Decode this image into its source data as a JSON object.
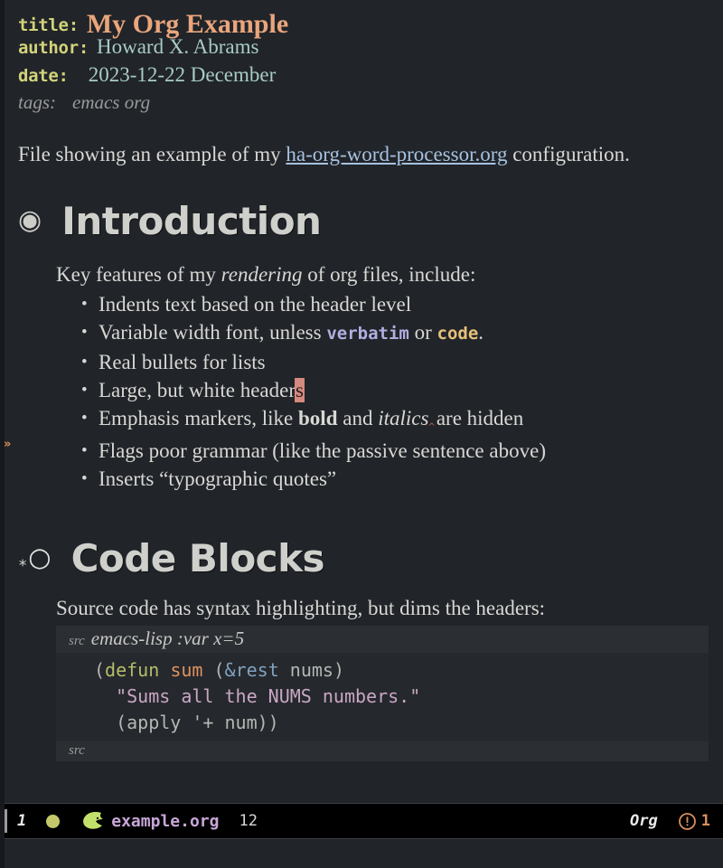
{
  "frame": {
    "background": "#212429",
    "accent_orange": "#d98f5a",
    "cursor_color": "#d6897e"
  },
  "keywords": [
    {
      "key": "title:",
      "value": "My Org Example"
    },
    {
      "key": "author:",
      "value": "Howard X. Abrams"
    },
    {
      "key": "date:",
      "value": "2023-12-22 December"
    }
  ],
  "tags": {
    "key": "tags:",
    "value": "emacs org"
  },
  "intro_paragraph": {
    "before_link": "File showing an example of my ",
    "link_text": "ha-org-word-processor.org",
    "after_link": " configuration."
  },
  "sections": [
    {
      "bullet": "filled-circle",
      "heading": "Introduction",
      "lead": {
        "before_italic": "Key features of my ",
        "italic": "rendering",
        "after_italic": " of org files, include:"
      },
      "items": [
        {
          "text": "Indents text based on the header level"
        },
        {
          "text": "Variable width font, unless ",
          "verbatim": "verbatim",
          "mid": " or ",
          "code": "code",
          "tail": "."
        },
        {
          "text": "Real bullets for lists"
        },
        {
          "text": "Large, but white header",
          "cursor_char": "s"
        },
        {
          "text": "Emphasis markers, like ",
          "bold": "bold",
          "mid": " and ",
          "italic": "italics",
          "tail": "are hidden"
        },
        {
          "text": "Flags poor grammar (like the passive sentence above)"
        },
        {
          "text": "Inserts “typographic quotes”"
        }
      ]
    },
    {
      "bullet": "open-circle",
      "star": "*",
      "heading": "Code Blocks",
      "lead": {
        "text": "Source code has syntax highlighting, but dims the headers:"
      },
      "src_block": {
        "begin_label": "src",
        "begin_args": "emacs-lisp :var x=5",
        "end_label": "src",
        "lines": [
          [
            {
              "t": "(",
              "c": "par"
            },
            {
              "t": "defun",
              "c": "kw"
            },
            {
              "t": " ",
              "c": "par"
            },
            {
              "t": "sum",
              "c": "fn"
            },
            {
              "t": " (",
              "c": "par"
            },
            {
              "t": "&rest",
              "c": "amp"
            },
            {
              "t": " nums)",
              "c": "par"
            }
          ],
          [
            {
              "t": "  \"Sums all the NUMS numbers.\"",
              "c": "str"
            }
          ],
          [
            {
              "t": "  (apply '+ num))",
              "c": "par"
            }
          ]
        ]
      }
    }
  ],
  "fringe": {
    "marker": "»"
  },
  "modeline": {
    "window_number": "1",
    "buffer_name": "example.org",
    "line_number": "12",
    "major_mode": "Org",
    "error_count": "1",
    "icons": {
      "status_dot": "status-dot",
      "emacs": "emacs-logo-icon",
      "error": "error-circle-icon"
    }
  }
}
